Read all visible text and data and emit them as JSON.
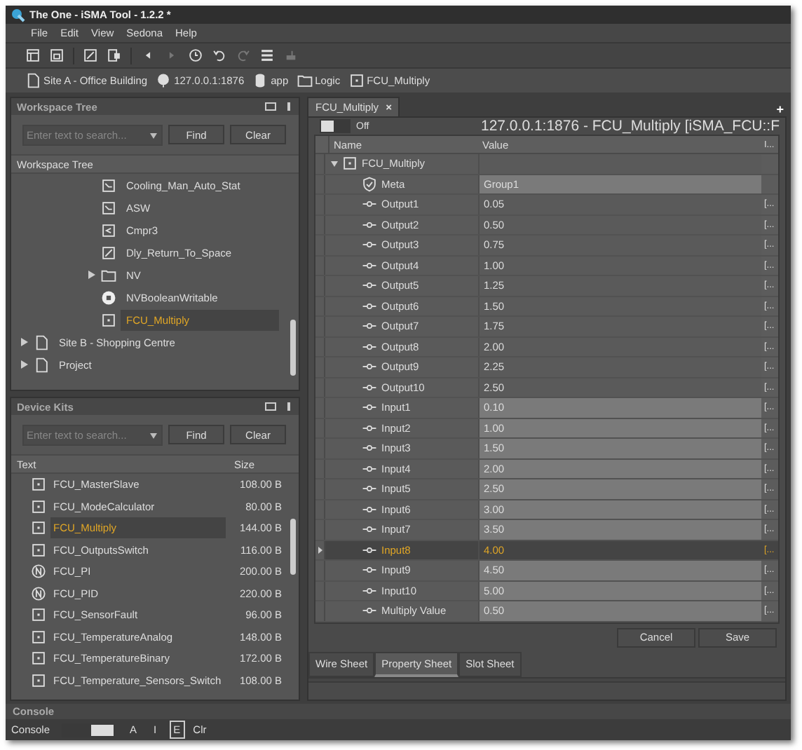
{
  "window": {
    "title": "The One - iSMA Tool - 1.2.2 *"
  },
  "menu": [
    "File",
    "Edit",
    "View",
    "Sedona",
    "Help"
  ],
  "toolbar": [
    {
      "kind": "layout",
      "disabled": false
    },
    {
      "kind": "save",
      "disabled": false
    },
    {
      "kind": "sep"
    },
    {
      "kind": "edit",
      "disabled": false
    },
    {
      "kind": "component",
      "disabled": false
    },
    {
      "kind": "sep"
    },
    {
      "kind": "back",
      "disabled": false
    },
    {
      "kind": "forward",
      "disabled": true
    },
    {
      "kind": "history",
      "disabled": false
    },
    {
      "kind": "undo",
      "disabled": false
    },
    {
      "kind": "redo",
      "disabled": true
    },
    {
      "kind": "list",
      "disabled": false
    },
    {
      "kind": "plug",
      "disabled": true
    }
  ],
  "breadcrumb": [
    {
      "kind": "page",
      "label": "Site A - Office Building"
    },
    {
      "kind": "device",
      "label": "127.0.0.1:1876"
    },
    {
      "kind": "db",
      "label": "app"
    },
    {
      "kind": "folder",
      "label": "Logic"
    },
    {
      "kind": "function",
      "label": "FCU_Multiply"
    }
  ],
  "workspace_tree": {
    "title": "Workspace Tree",
    "search": {
      "placeholder": "Enter text to search..."
    },
    "find": "Find",
    "clear": "Clear",
    "column": "Workspace Tree",
    "items": [
      {
        "children": [
          {
            "children": [
              {
                "children": [
                  {
                    "label": "Cooling_Man_Auto_Stat",
                    "kind": "chart",
                    "expandable": false,
                    "selected": false
                  },
                  {
                    "label": "ASW",
                    "kind": "chart",
                    "expandable": false,
                    "selected": false
                  },
                  {
                    "label": "Cmpr3",
                    "kind": "compare",
                    "expandable": false,
                    "selected": false
                  },
                  {
                    "label": "Dly_Return_To_Space",
                    "kind": "edit",
                    "expandable": false,
                    "selected": false
                  },
                  {
                    "label": "NV",
                    "kind": "folder",
                    "expandable": true,
                    "selected": false
                  },
                  {
                    "label": "NVBooleanWritable",
                    "kind": "bool",
                    "expandable": false,
                    "selected": false
                  },
                  {
                    "label": "FCU_Multiply",
                    "kind": "function",
                    "expandable": false,
                    "selected": true
                  }
                ]
              }
            ]
          }
        ]
      },
      {
        "label": "Site B - Shopping Centre",
        "kind": "page",
        "expandable": true,
        "selected": false
      },
      {
        "label": "Project",
        "kind": "page",
        "expandable": true,
        "selected": false
      }
    ]
  },
  "device_kits": {
    "title": "Device Kits",
    "search": {
      "placeholder": "Enter text to search..."
    },
    "find": "Find",
    "clear": "Clear",
    "columns": [
      "Text",
      "Size"
    ],
    "rows": [
      {
        "name": "FCU_MasterSlave",
        "size": "108.00 B",
        "kind": "function",
        "selected": false
      },
      {
        "name": "FCU_ModeCalculator",
        "size": "80.00 B",
        "kind": "function",
        "selected": false
      },
      {
        "name": "FCU_Multiply",
        "size": "144.00 B",
        "kind": "function",
        "selected": true
      },
      {
        "name": "FCU_OutputsSwitch",
        "size": "116.00 B",
        "kind": "function",
        "selected": false
      },
      {
        "name": "FCU_PI",
        "size": "200.00 B",
        "kind": "native",
        "selected": false
      },
      {
        "name": "FCU_PID",
        "size": "220.00 B",
        "kind": "native",
        "selected": false
      },
      {
        "name": "FCU_SensorFault",
        "size": "96.00 B",
        "kind": "function",
        "selected": false
      },
      {
        "name": "FCU_TemperatureAnalog",
        "size": "148.00 B",
        "kind": "function",
        "selected": false
      },
      {
        "name": "FCU_TemperatureBinary",
        "size": "172.00 B",
        "kind": "function",
        "selected": false
      },
      {
        "name": "FCU_Temperature_Sensors_Switch",
        "size": "108.00 B",
        "kind": "function",
        "selected": false
      }
    ]
  },
  "console": {
    "title": "Console",
    "label": "Console",
    "toggle_on": true,
    "filters": [
      {
        "label": "A",
        "selected": false
      },
      {
        "label": "I",
        "selected": false
      },
      {
        "label": "E",
        "selected": true
      }
    ],
    "clear": "Clr"
  },
  "editor": {
    "tab": "FCU_Multiply",
    "tab_close": "×",
    "add": "+",
    "switch": {
      "label": "Off",
      "on": false
    },
    "heading": "127.0.0.1:1876 - FCU_Multiply [iSMA_FCU::F",
    "columns": [
      "Name",
      "Value",
      "I..."
    ],
    "rows": [
      {
        "kind": "group",
        "name": "FCU_Multiply",
        "value": "",
        "extra": "",
        "editable": false,
        "selected": false
      },
      {
        "kind": "meta",
        "name": "Meta",
        "value": "Group1",
        "extra": "",
        "editable": true,
        "selected": false
      },
      {
        "kind": "slot",
        "name": "Output1",
        "value": "0.05",
        "extra": "[...",
        "editable": false,
        "selected": false
      },
      {
        "kind": "slot",
        "name": "Output2",
        "value": "0.50",
        "extra": "[...",
        "editable": false,
        "selected": false
      },
      {
        "kind": "slot",
        "name": "Output3",
        "value": "0.75",
        "extra": "[...",
        "editable": false,
        "selected": false
      },
      {
        "kind": "slot",
        "name": "Output4",
        "value": "1.00",
        "extra": "[...",
        "editable": false,
        "selected": false
      },
      {
        "kind": "slot",
        "name": "Output5",
        "value": "1.25",
        "extra": "[...",
        "editable": false,
        "selected": false
      },
      {
        "kind": "slot",
        "name": "Output6",
        "value": "1.50",
        "extra": "[...",
        "editable": false,
        "selected": false
      },
      {
        "kind": "slot",
        "name": "Output7",
        "value": "1.75",
        "extra": "[...",
        "editable": false,
        "selected": false
      },
      {
        "kind": "slot",
        "name": "Output8",
        "value": "2.00",
        "extra": "[...",
        "editable": false,
        "selected": false
      },
      {
        "kind": "slot",
        "name": "Output9",
        "value": "2.25",
        "extra": "[...",
        "editable": false,
        "selected": false
      },
      {
        "kind": "slot",
        "name": "Output10",
        "value": "2.50",
        "extra": "[...",
        "editable": false,
        "selected": false
      },
      {
        "kind": "slot",
        "name": "Input1",
        "value": "0.10",
        "extra": "[...",
        "editable": true,
        "selected": false
      },
      {
        "kind": "slot",
        "name": "Input2",
        "value": "1.00",
        "extra": "[...",
        "editable": true,
        "selected": false
      },
      {
        "kind": "slot",
        "name": "Input3",
        "value": "1.50",
        "extra": "[...",
        "editable": true,
        "selected": false
      },
      {
        "kind": "slot",
        "name": "Input4",
        "value": "2.00",
        "extra": "[...",
        "editable": true,
        "selected": false
      },
      {
        "kind": "slot",
        "name": "Input5",
        "value": "2.50",
        "extra": "[...",
        "editable": true,
        "selected": false
      },
      {
        "kind": "slot",
        "name": "Input6",
        "value": "3.00",
        "extra": "[...",
        "editable": true,
        "selected": false
      },
      {
        "kind": "slot",
        "name": "Input7",
        "value": "3.50",
        "extra": "[...",
        "editable": true,
        "selected": false
      },
      {
        "kind": "slot",
        "name": "Input8",
        "value": "4.00",
        "extra": "[...",
        "editable": true,
        "selected": true
      },
      {
        "kind": "slot",
        "name": "Input9",
        "value": "4.50",
        "extra": "[...",
        "editable": true,
        "selected": false
      },
      {
        "kind": "slot",
        "name": "Input10",
        "value": "5.00",
        "extra": "[...",
        "editable": true,
        "selected": false
      },
      {
        "kind": "slot",
        "name": "Multiply Value",
        "value": "0.50",
        "extra": "[...",
        "editable": true,
        "selected": false
      }
    ],
    "buttons": [
      "Cancel",
      "Save"
    ],
    "sheets": [
      {
        "label": "Wire Sheet",
        "selected": false
      },
      {
        "label": "Property Sheet",
        "selected": true
      },
      {
        "label": "Slot Sheet",
        "selected": false
      }
    ]
  }
}
